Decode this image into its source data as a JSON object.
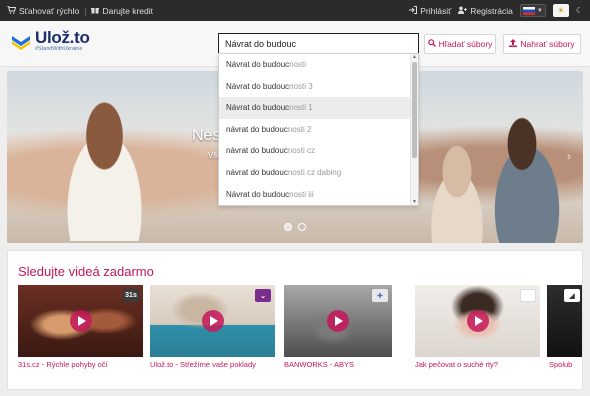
{
  "topbar": {
    "download_fast": "Sťahovať rýchlo",
    "gift_credit": "Darujte kredit",
    "login": "Prihlásiť",
    "register": "Registrácia"
  },
  "brand": {
    "name": "Ulož.to",
    "tagline": "#StandWithUkraine",
    "colors": {
      "accent": "#c4175a",
      "navy": "#1c2f6b",
      "ukraine_blue": "#1f6fd6",
      "ukraine_yellow": "#f5c400"
    }
  },
  "search": {
    "value": "Návrat do budouc",
    "search_button": "Hľadať súbory",
    "upload_button": "Nahrať súbory"
  },
  "suggestions": {
    "items": [
      {
        "typed": "Návrat do budouc",
        "rest": "nosti"
      },
      {
        "typed": "Návrat do budouc",
        "rest": "nosti 3"
      },
      {
        "typed": "Návrat do budouc",
        "rest": "nosti 1"
      },
      {
        "typed": "návrat do budouc",
        "rest": "nosti 2"
      },
      {
        "typed": "návrat do budouc",
        "rest": "nosti cz"
      },
      {
        "typed": "návrat do budouc",
        "rest": "nosti cz dabing"
      },
      {
        "typed": "Návrat do budouc",
        "rest": "nosti iii"
      }
    ]
  },
  "hero": {
    "title": "Nes",
    "subtitle": "Vše",
    "arrow": "›"
  },
  "videos": {
    "title": "Sledujte videá zadarmo",
    "items": [
      {
        "label": "31s.cz - Rýchle pohyby očí",
        "badge": "31s"
      },
      {
        "label": "Ulož.to - Střežíme vaše poklady",
        "badge": ""
      },
      {
        "label": "BANWORKS - ABYS",
        "badge": ""
      },
      {
        "label": "Jak pečovat o suché rty?",
        "badge": ""
      },
      {
        "label": "Spolub",
        "badge": ""
      }
    ]
  }
}
